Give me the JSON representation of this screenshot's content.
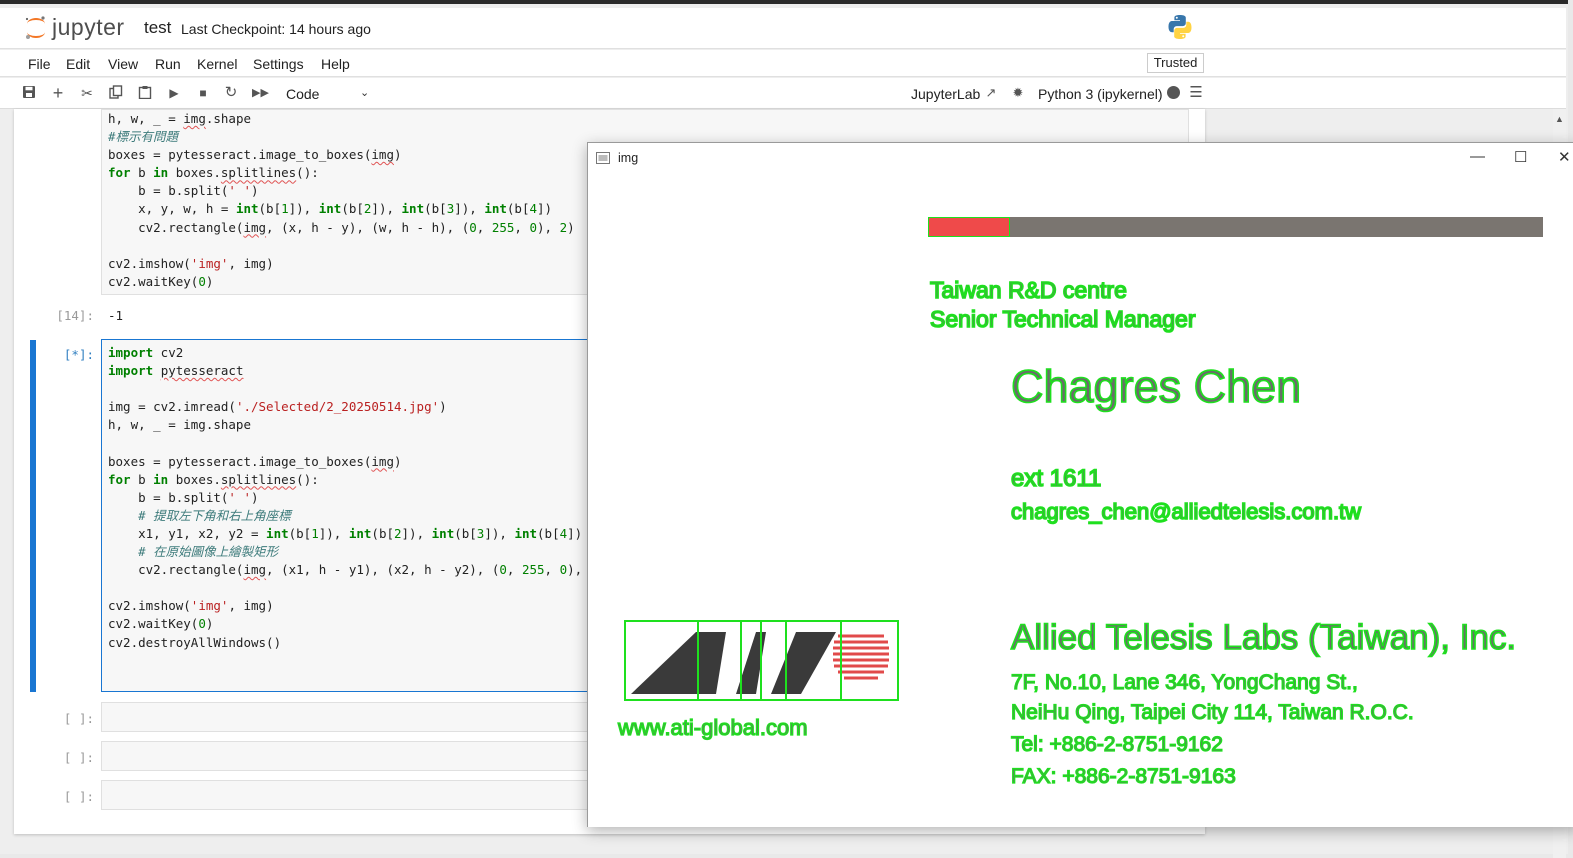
{
  "header": {
    "logo_text": "jupyter",
    "notebook_title": "test",
    "checkpoint": "Last Checkpoint: 14 hours ago"
  },
  "menu": {
    "items": [
      "File",
      "Edit",
      "View",
      "Run",
      "Kernel",
      "Settings",
      "Help"
    ],
    "trusted": "Trusted"
  },
  "toolbar": {
    "cell_type": "Code",
    "jupyterlab": "JupyterLab",
    "kernel": "Python 3 (ipykernel)"
  },
  "cells": {
    "cell1_prompt": "",
    "cell1_output_prompt": "[14]:",
    "cell1_output": "-1",
    "cell2_prompt": "[*]:",
    "empty_prompt": "[ ]:"
  },
  "cv_window": {
    "title": "img",
    "minimize": "—",
    "maximize": "☐",
    "close": "✕",
    "lines": {
      "taiwan_rd": "Taiwan R&D centre",
      "title": "Senior Technical Manager",
      "name": "Chagres Chen",
      "ext": "ext 1611",
      "email": "chagres_chen@alliedtelesis.com.tw",
      "company": "Allied Telesis Labs (Taiwan), Inc.",
      "addr1": "7F, No.10, Lane 346, YongChang St.,",
      "addr2": "NeiHu Qing, Taipei City 114, Taiwan R.O.C.",
      "tel": "Tel: +886-2-8751-9162",
      "fax": "FAX: +886-2-8751-9163",
      "web": "www.ati-global.com"
    }
  }
}
